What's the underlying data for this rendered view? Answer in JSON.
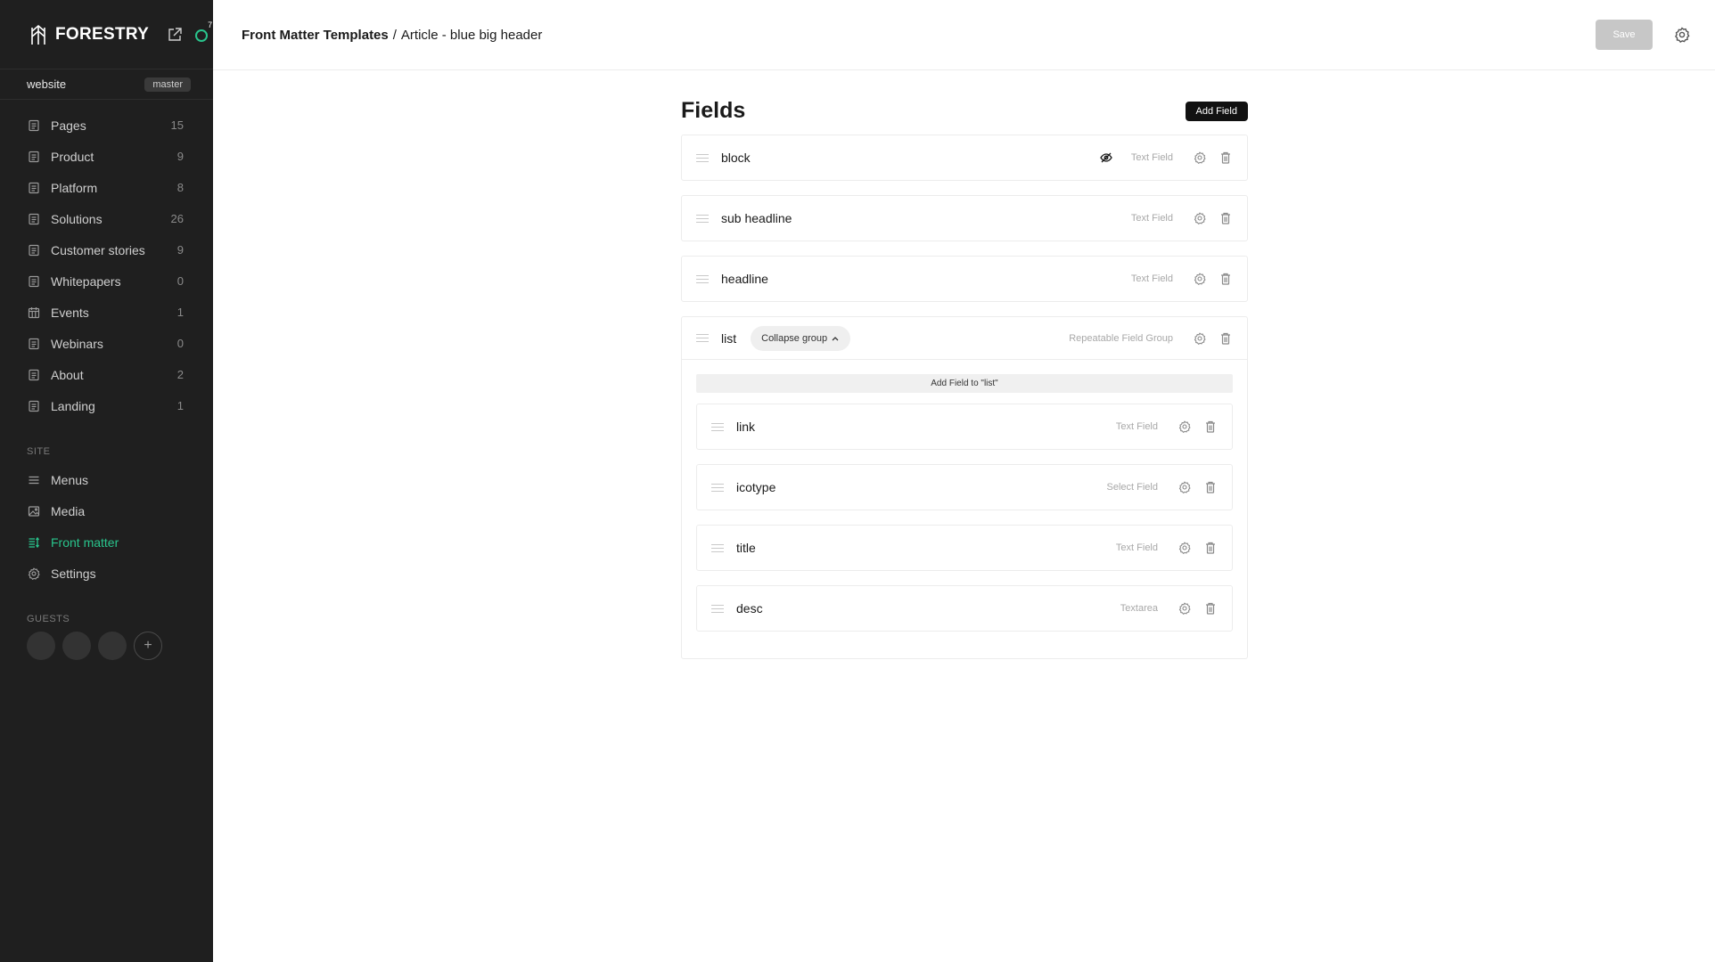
{
  "sidebar": {
    "brand": "FORESTRY",
    "notification_count": "7",
    "site_name": "website",
    "branch": "master",
    "nav": [
      {
        "label": "Pages",
        "count": "15",
        "icon": "document-icon"
      },
      {
        "label": "Product",
        "count": "9",
        "icon": "document-icon"
      },
      {
        "label": "Platform",
        "count": "8",
        "icon": "document-icon"
      },
      {
        "label": "Solutions",
        "count": "26",
        "icon": "document-icon"
      },
      {
        "label": "Customer stories",
        "count": "9",
        "icon": "document-icon"
      },
      {
        "label": "Whitepapers",
        "count": "0",
        "icon": "document-icon"
      },
      {
        "label": "Events",
        "count": "1",
        "icon": "calendar-icon"
      },
      {
        "label": "Webinars",
        "count": "0",
        "icon": "document-icon"
      },
      {
        "label": "About",
        "count": "2",
        "icon": "document-icon"
      },
      {
        "label": "Landing",
        "count": "1",
        "icon": "document-icon"
      }
    ],
    "site_section_label": "SITE",
    "site_items": [
      {
        "label": "Menus",
        "icon": "menu-icon"
      },
      {
        "label": "Media",
        "icon": "image-icon"
      },
      {
        "label": "Front matter",
        "icon": "front-matter-icon",
        "active": true
      },
      {
        "label": "Settings",
        "icon": "gear-icon"
      }
    ],
    "guests_label": "GUESTS",
    "add_guest_label": "+"
  },
  "header": {
    "breadcrumb_parent": "Front Matter Templates",
    "breadcrumb_sep": "/",
    "breadcrumb_current": "Article - blue big header",
    "save_label": "Save"
  },
  "main": {
    "title": "Fields",
    "add_field_label": "Add Field",
    "fields": [
      {
        "name": "block",
        "type": "Text Field",
        "hidden": true
      },
      {
        "name": "sub headline",
        "type": "Text Field"
      },
      {
        "name": "headline",
        "type": "Text Field"
      }
    ],
    "group": {
      "name": "list",
      "collapse_label": "Collapse group",
      "type": "Repeatable Field Group",
      "add_to_group_label": "Add Field to \"list\"",
      "fields": [
        {
          "name": "link",
          "type": "Text Field"
        },
        {
          "name": "icotype",
          "type": "Select Field"
        },
        {
          "name": "title",
          "type": "Text Field"
        },
        {
          "name": "desc",
          "type": "Textarea"
        }
      ]
    }
  },
  "colors": {
    "accent": "#29c48c",
    "sidebar_bg": "#1f1f1f"
  }
}
